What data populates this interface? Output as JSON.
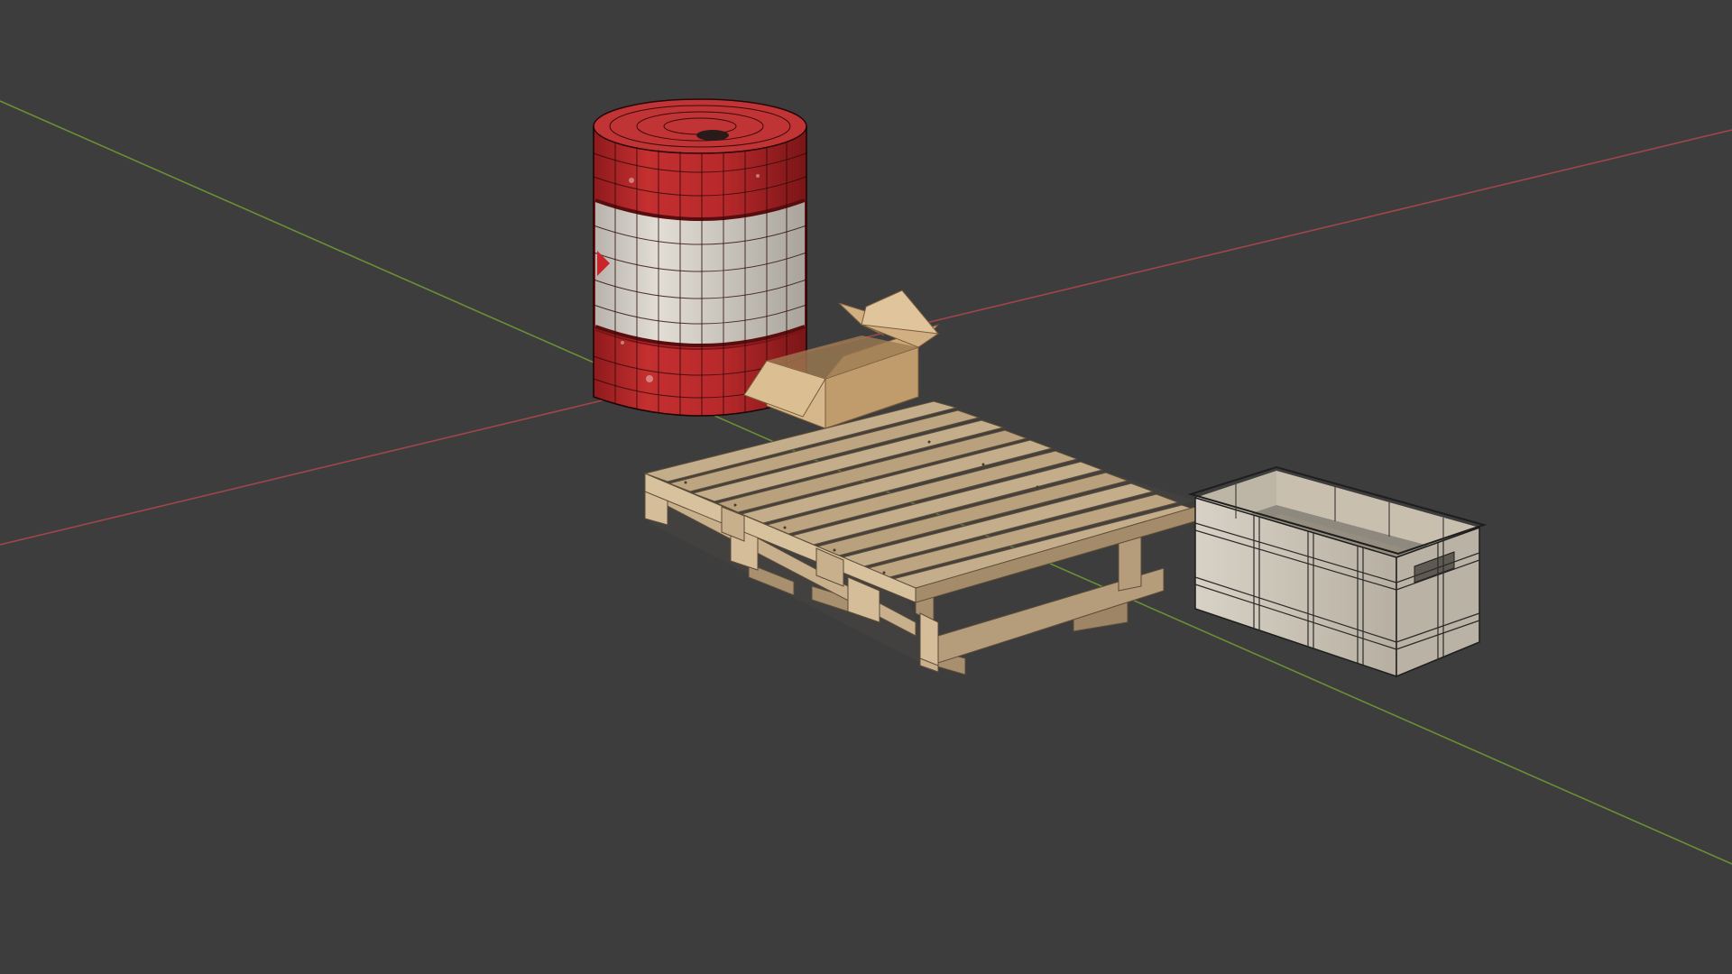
{
  "viewport": {
    "background": "#3d3d3d",
    "mode": "solid-shaded-with-wireframe-overlay"
  },
  "axes": {
    "x_axis_color": "#a0464b",
    "y_axis_color": "#6a8f35"
  },
  "scene_objects": [
    {
      "name": "oil-barrel",
      "colors": {
        "red": "#b5272a",
        "band": "#d3cfc8"
      }
    },
    {
      "name": "cardboard-box",
      "colors": {
        "cardboard": "#c9a577"
      }
    },
    {
      "name": "wooden-pallet",
      "colors": {
        "wood": "#b8a282"
      }
    },
    {
      "name": "plastic-crate",
      "colors": {
        "plastic": "#c8c2b7"
      }
    }
  ]
}
